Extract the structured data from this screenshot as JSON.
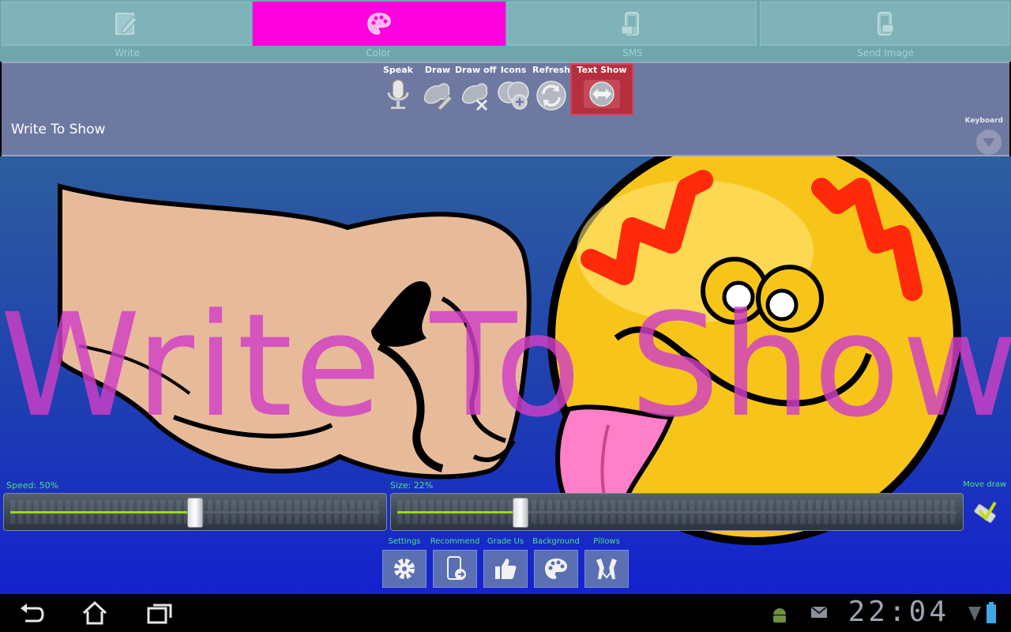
{
  "tabs": [
    {
      "label": "Write",
      "icon": "pencil-icon"
    },
    {
      "label": "Color",
      "icon": "palette-icon"
    },
    {
      "label": "SMS",
      "icon": "phone-icon"
    },
    {
      "label": "Send Image",
      "icon": "phone-image-icon"
    }
  ],
  "toolbar": {
    "speak": "Speak",
    "draw": "Draw",
    "draw_off": "Draw off",
    "icons": "Icons",
    "refresh": "Refresh",
    "text_show": "Text Show"
  },
  "input": {
    "value": "Write To Show",
    "keyboard_label": "Keyboard"
  },
  "canvas": {
    "display_text": "Write To Show"
  },
  "sliders": {
    "speed_label": "Speed: 50%",
    "speed_value": 0.5,
    "size_label": "Size: 22%",
    "size_value": 0.22
  },
  "move_draw_label": "Move draw",
  "bottom_buttons": [
    {
      "label": "Settings",
      "icon": "gear-icon"
    },
    {
      "label": "Recommend",
      "icon": "recommend-phone-icon"
    },
    {
      "label": "Grade Us",
      "icon": "thumbs-up-icon"
    },
    {
      "label": "Background",
      "icon": "palette-icon"
    },
    {
      "label": "Pillows",
      "icon": "pillows-icon"
    }
  ],
  "system": {
    "time": "22:04"
  },
  "colors": {
    "active_tab": "#ff00de",
    "canvas_text": "#d13fc7",
    "label_green": "#4ee37b",
    "active_tool": "#b52f3f"
  }
}
